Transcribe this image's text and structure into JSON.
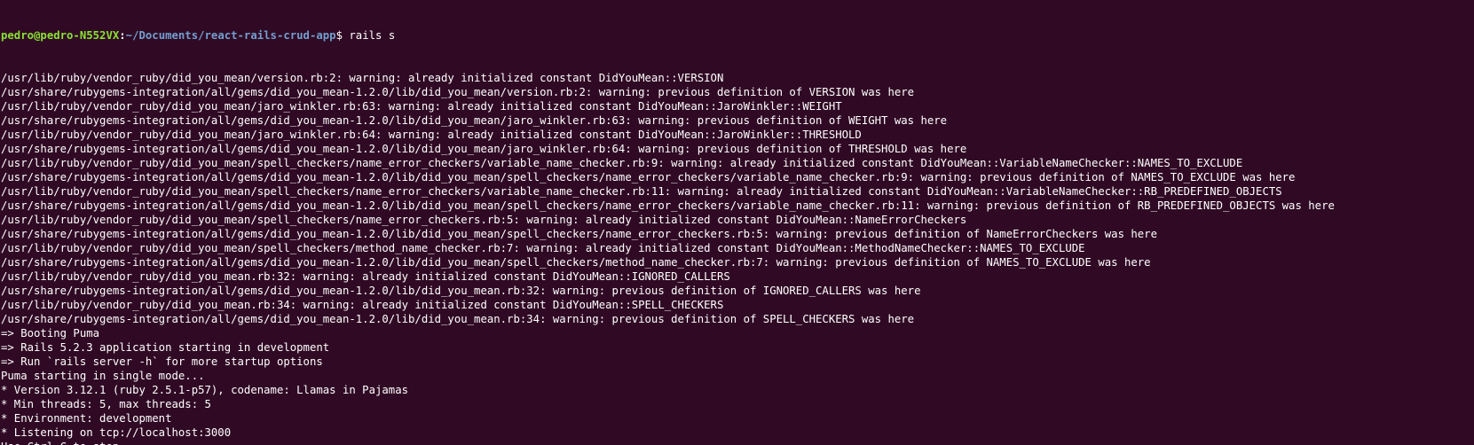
{
  "prompt": {
    "user_host": "pedro@pedro-N552VX",
    "separator": ":",
    "path": "~/Documents/react-rails-crud-app",
    "dollar": "$ ",
    "command": "rails s"
  },
  "output_lines": [
    "/usr/lib/ruby/vendor_ruby/did_you_mean/version.rb:2: warning: already initialized constant DidYouMean::VERSION",
    "/usr/share/rubygems-integration/all/gems/did_you_mean-1.2.0/lib/did_you_mean/version.rb:2: warning: previous definition of VERSION was here",
    "/usr/lib/ruby/vendor_ruby/did_you_mean/jaro_winkler.rb:63: warning: already initialized constant DidYouMean::JaroWinkler::WEIGHT",
    "/usr/share/rubygems-integration/all/gems/did_you_mean-1.2.0/lib/did_you_mean/jaro_winkler.rb:63: warning: previous definition of WEIGHT was here",
    "/usr/lib/ruby/vendor_ruby/did_you_mean/jaro_winkler.rb:64: warning: already initialized constant DidYouMean::JaroWinkler::THRESHOLD",
    "/usr/share/rubygems-integration/all/gems/did_you_mean-1.2.0/lib/did_you_mean/jaro_winkler.rb:64: warning: previous definition of THRESHOLD was here",
    "/usr/lib/ruby/vendor_ruby/did_you_mean/spell_checkers/name_error_checkers/variable_name_checker.rb:9: warning: already initialized constant DidYouMean::VariableNameChecker::NAMES_TO_EXCLUDE",
    "/usr/share/rubygems-integration/all/gems/did_you_mean-1.2.0/lib/did_you_mean/spell_checkers/name_error_checkers/variable_name_checker.rb:9: warning: previous definition of NAMES_TO_EXCLUDE was here",
    "/usr/lib/ruby/vendor_ruby/did_you_mean/spell_checkers/name_error_checkers/variable_name_checker.rb:11: warning: already initialized constant DidYouMean::VariableNameChecker::RB_PREDEFINED_OBJECTS",
    "/usr/share/rubygems-integration/all/gems/did_you_mean-1.2.0/lib/did_you_mean/spell_checkers/name_error_checkers/variable_name_checker.rb:11: warning: previous definition of RB_PREDEFINED_OBJECTS was here",
    "/usr/lib/ruby/vendor_ruby/did_you_mean/spell_checkers/name_error_checkers.rb:5: warning: already initialized constant DidYouMean::NameErrorCheckers",
    "/usr/share/rubygems-integration/all/gems/did_you_mean-1.2.0/lib/did_you_mean/spell_checkers/name_error_checkers.rb:5: warning: previous definition of NameErrorCheckers was here",
    "/usr/lib/ruby/vendor_ruby/did_you_mean/spell_checkers/method_name_checker.rb:7: warning: already initialized constant DidYouMean::MethodNameChecker::NAMES_TO_EXCLUDE",
    "/usr/share/rubygems-integration/all/gems/did_you_mean-1.2.0/lib/did_you_mean/spell_checkers/method_name_checker.rb:7: warning: previous definition of NAMES_TO_EXCLUDE was here",
    "/usr/lib/ruby/vendor_ruby/did_you_mean.rb:32: warning: already initialized constant DidYouMean::IGNORED_CALLERS",
    "/usr/share/rubygems-integration/all/gems/did_you_mean-1.2.0/lib/did_you_mean.rb:32: warning: previous definition of IGNORED_CALLERS was here",
    "/usr/lib/ruby/vendor_ruby/did_you_mean.rb:34: warning: already initialized constant DidYouMean::SPELL_CHECKERS",
    "/usr/share/rubygems-integration/all/gems/did_you_mean-1.2.0/lib/did_you_mean.rb:34: warning: previous definition of SPELL_CHECKERS was here",
    "=> Booting Puma",
    "=> Rails 5.2.3 application starting in development",
    "=> Run `rails server -h` for more startup options",
    "Puma starting in single mode...",
    "* Version 3.12.1 (ruby 2.5.1-p57), codename: Llamas in Pajamas",
    "* Min threads: 5, max threads: 5",
    "* Environment: development",
    "* Listening on tcp://localhost:3000",
    "Use Ctrl-C to stop"
  ],
  "colors": {
    "background": "#300a24",
    "text": "#ffffff",
    "prompt_user": "#8ae234",
    "prompt_path": "#729fcf"
  }
}
